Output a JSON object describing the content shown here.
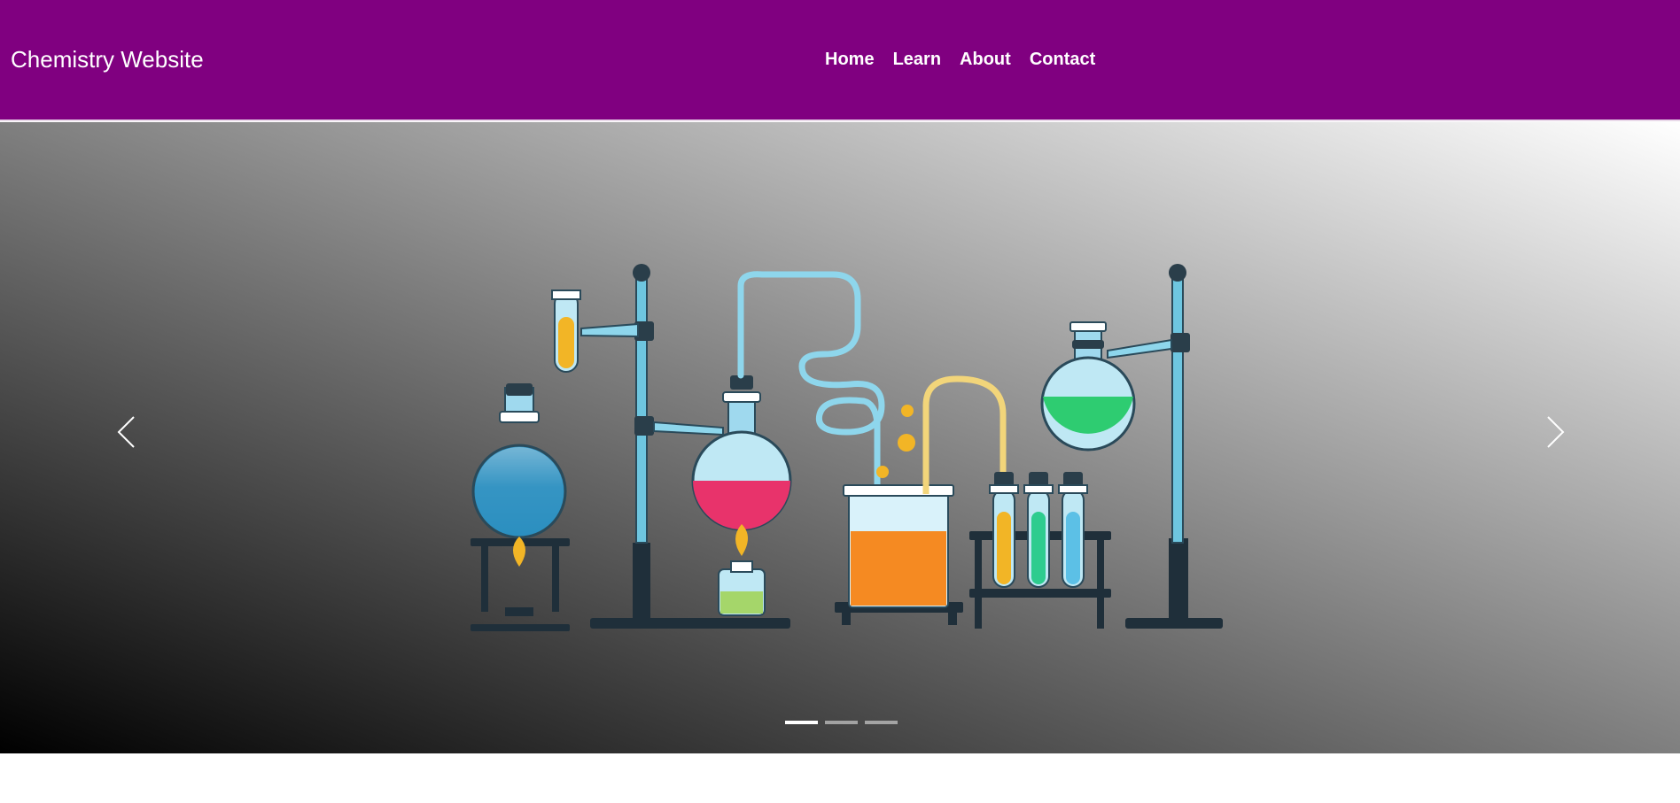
{
  "navbar": {
    "brand": "Chemistry Website",
    "bg_color": "#800080",
    "links": [
      "Home",
      "Learn",
      "About",
      "Contact"
    ]
  },
  "carousel": {
    "prev_icon": "chevron-left-icon",
    "next_icon": "chevron-right-icon",
    "slide_count": 3,
    "active_slide": 1,
    "slide_image": "chemistry-lab-equipment-illustration"
  }
}
